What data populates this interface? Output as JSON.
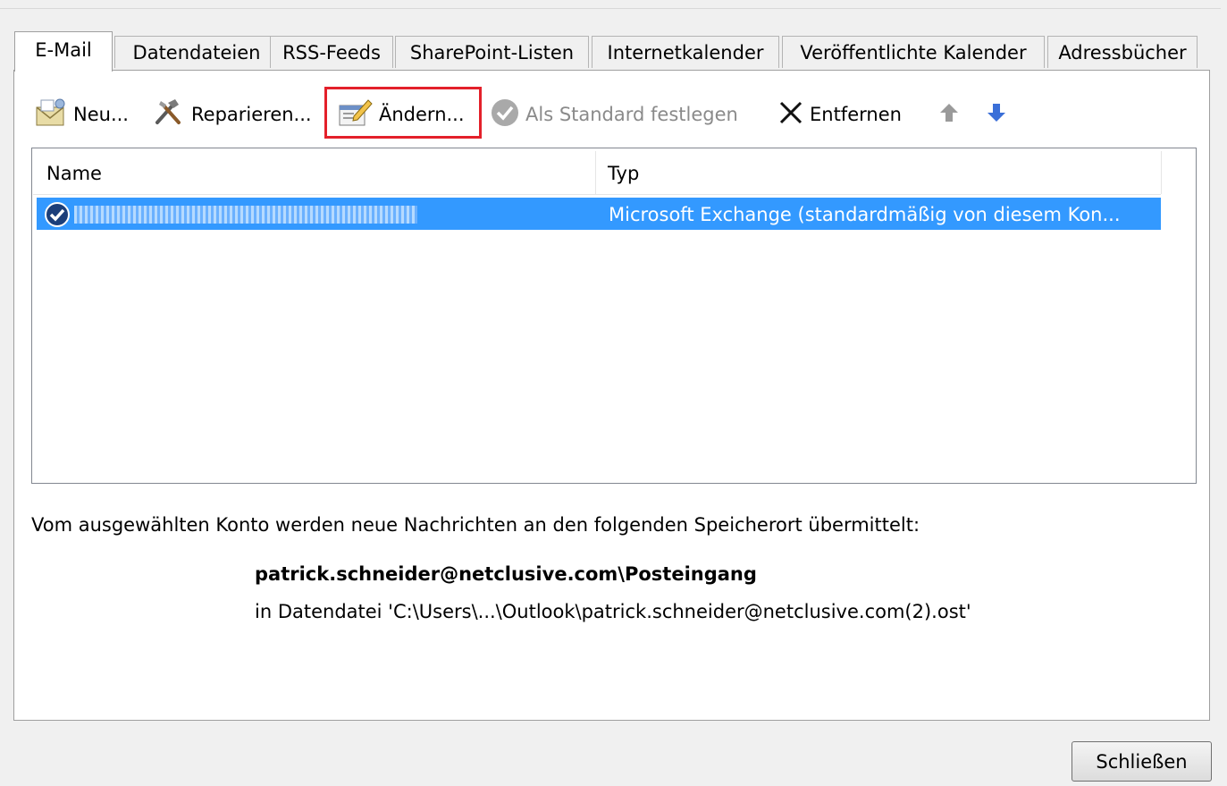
{
  "tabs": [
    {
      "label": "E-Mail"
    },
    {
      "label": "Datendateien"
    },
    {
      "label": "RSS-Feeds"
    },
    {
      "label": "SharePoint-Listen"
    },
    {
      "label": "Internetkalender"
    },
    {
      "label": "Veröffentlichte Kalender"
    },
    {
      "label": "Adressbücher"
    }
  ],
  "toolbar": {
    "new_label": "Neu...",
    "repair_label": "Reparieren...",
    "change_label": "Ändern...",
    "set_default_label": "Als Standard festlegen",
    "remove_label": "Entfernen"
  },
  "list": {
    "columns": [
      "Name",
      "Typ"
    ],
    "rows": [
      {
        "type": "Microsoft Exchange (standardmäßig von diesem Kon..."
      }
    ]
  },
  "info": {
    "description": "Vom ausgewählten Konto werden neue Nachrichten an den folgenden Speicherort übermittelt:",
    "folder": "patrick.schneider@netclusive.com\\Posteingang",
    "datafile": "in Datendatei 'C:\\Users\\...\\Outlook\\patrick.schneider@netclusive.com(2).ost'"
  },
  "buttons": {
    "close_label": "Schließen"
  },
  "colors": {
    "selection": "#3399ff",
    "highlight_box": "#e3202a",
    "arrow_down": "#3a6fd8"
  }
}
